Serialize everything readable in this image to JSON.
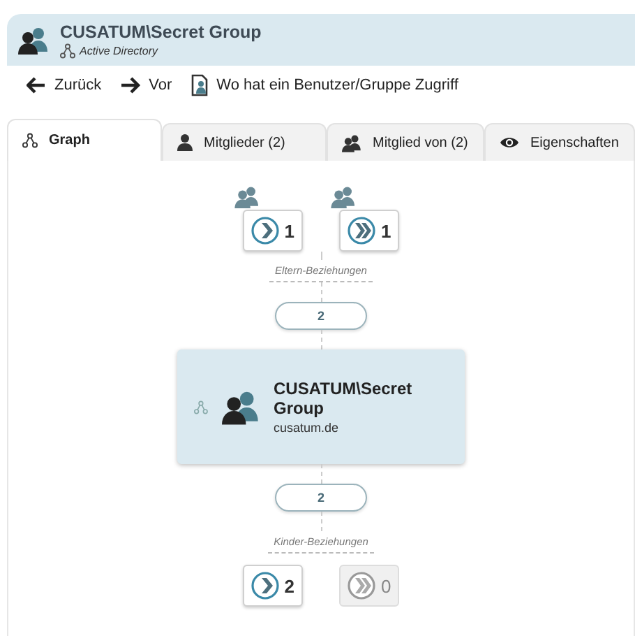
{
  "header": {
    "title": "CUSATUM\\Secret Group",
    "subtitle": "Active Directory"
  },
  "toolbar": [
    {
      "kind": "back",
      "label": "Zurück"
    },
    {
      "kind": "forward",
      "label": "Vor"
    },
    {
      "kind": "access",
      "label": "Wo hat ein Benutzer/Gruppe Zugriff"
    }
  ],
  "tabs": [
    {
      "kind": "graph",
      "label": "Graph",
      "selected": true
    },
    {
      "kind": "members",
      "label": "Mitglieder (2)",
      "selected": false
    },
    {
      "kind": "memberof",
      "label": "Mitglied von (2)",
      "selected": false
    },
    {
      "kind": "properties",
      "label": "Eigenschaften",
      "selected": false
    }
  ],
  "graph": {
    "parents": {
      "label": "Eltern-Beziehungen",
      "count": "2",
      "buttons": [
        {
          "kind": "direct",
          "count": "1",
          "disabled": false
        },
        {
          "kind": "nested",
          "count": "1",
          "disabled": false
        }
      ]
    },
    "node": {
      "title": "CUSATUM\\Secret Group",
      "domain": "cusatum.de"
    },
    "children": {
      "label": "Kinder-Beziehungen",
      "count": "2",
      "buttons": [
        {
          "kind": "direct",
          "count": "2",
          "disabled": false
        },
        {
          "kind": "nested",
          "count": "0",
          "disabled": true
        }
      ]
    }
  }
}
